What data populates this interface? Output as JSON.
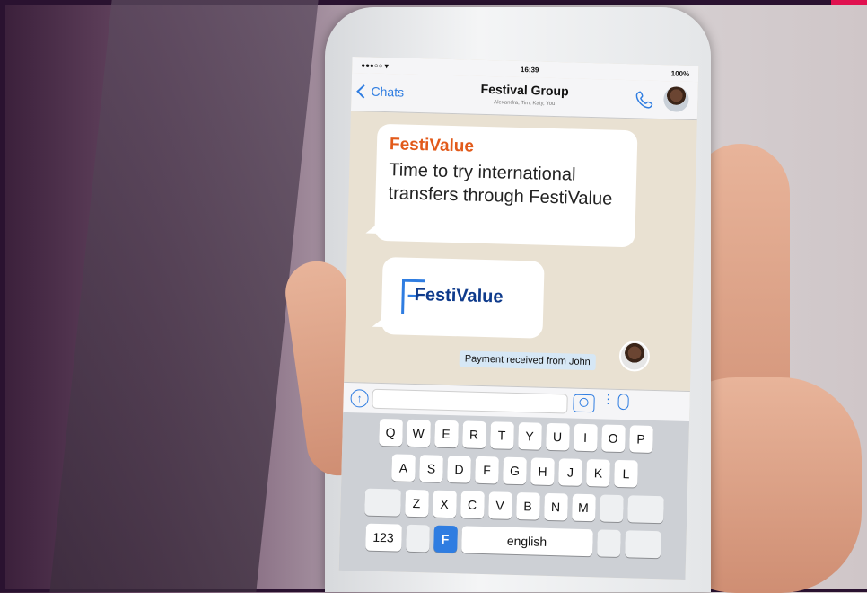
{
  "status_bar": {
    "signal": "●●●○○ ▾",
    "time": "16:39",
    "battery": "100%"
  },
  "nav": {
    "back_label": "Chats",
    "title": "Festival Group",
    "subtitle": "Alexandra, Tim, Katy, You"
  },
  "messages": [
    {
      "sender": "FestiValue",
      "text": "Time to try international transfers through FestiValue"
    },
    {
      "logo_text": "FestiValue"
    }
  ],
  "system_message": "Payment received from John",
  "input": {
    "placeholder": "",
    "upload_icon": "↑",
    "dots": "⋮"
  },
  "keyboard": {
    "row1": [
      "Q",
      "W",
      "E",
      "R",
      "T",
      "Y",
      "U",
      "I",
      "O",
      "P"
    ],
    "row2": [
      "A",
      "S",
      "D",
      "F",
      "G",
      "H",
      "J",
      "K",
      "L"
    ],
    "row3": [
      "Z",
      "X",
      "C",
      "V",
      "B",
      "N",
      "M"
    ],
    "numbers_key": "123",
    "festi_key": "F",
    "space_key": "english"
  },
  "colors": {
    "accent": "#2f7de1",
    "brand_orange": "#e25a1a",
    "brand_navy": "#0f3b8c",
    "frame": "#2a1230",
    "corner": "#e0114f"
  }
}
